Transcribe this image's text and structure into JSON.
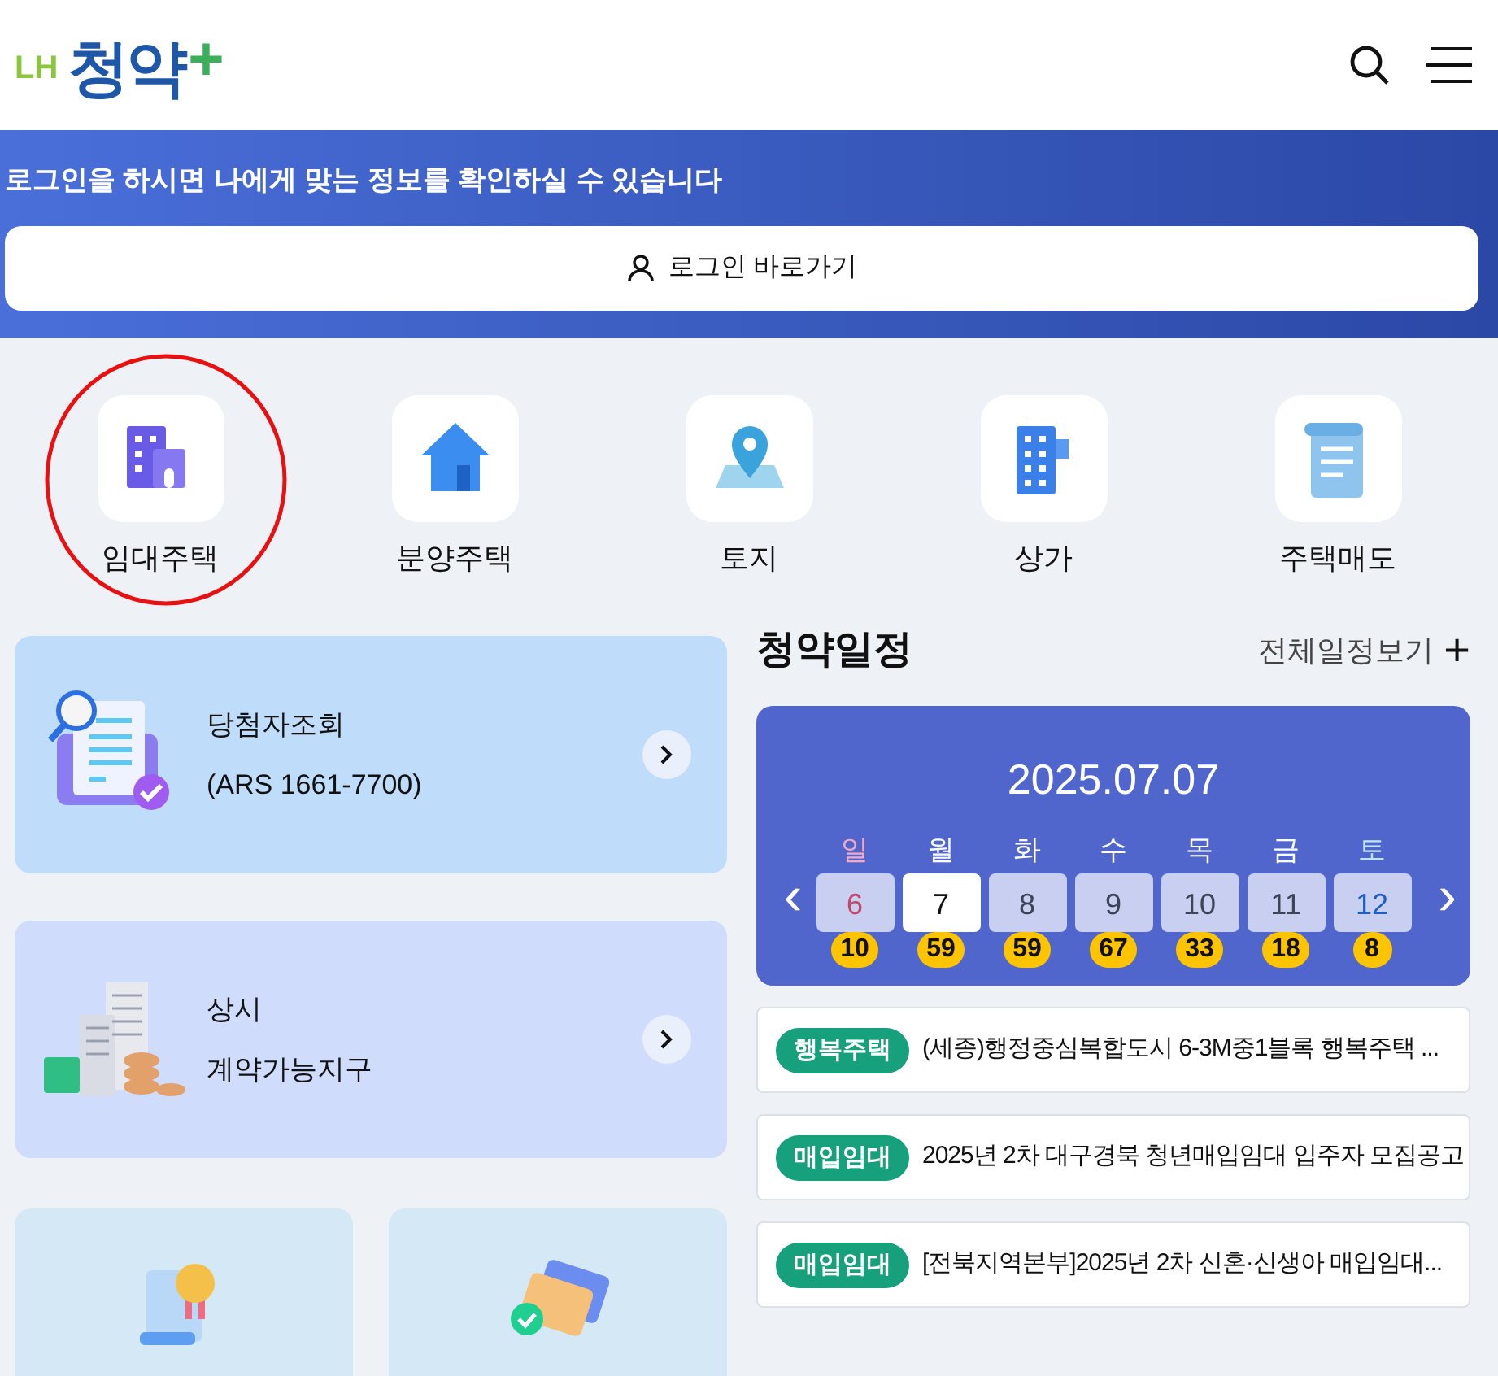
{
  "header": {
    "logo_prefix": "LH",
    "logo": "청약",
    "logo_plus": "+"
  },
  "banner": {
    "message": "로그인을 하시면 나에게 맞는 정보를 확인하실 수 있습니다",
    "login_button": "로그인 바로가기"
  },
  "quick_menu": [
    {
      "label": "임대주택",
      "kind": "rent",
      "highlighted": true
    },
    {
      "label": "분양주택",
      "kind": "sale",
      "highlighted": false
    },
    {
      "label": "토지",
      "kind": "land",
      "highlighted": false
    },
    {
      "label": "상가",
      "kind": "shop",
      "highlighted": false
    },
    {
      "label": "주택매도",
      "kind": "sell",
      "highlighted": false
    }
  ],
  "cards": [
    {
      "kind": "winner",
      "line1": "당첨자조회",
      "line2": "(ARS 1661-7700)"
    },
    {
      "kind": "contract",
      "line1": "상시",
      "line2": "계약가능지구"
    }
  ],
  "tiles": [
    {
      "kind": "award"
    },
    {
      "kind": "card"
    }
  ],
  "schedule": {
    "title": "청약일정",
    "more": "전체일정보기",
    "more_icon": "+",
    "date": "2025.07.07",
    "prev": "‹",
    "next": "›",
    "days": [
      {
        "weekday": "일",
        "day": "6",
        "count": "10",
        "kind": "sun",
        "selected": false
      },
      {
        "weekday": "월",
        "day": "7",
        "count": "59",
        "kind": "weekday",
        "selected": true
      },
      {
        "weekday": "화",
        "day": "8",
        "count": "59",
        "kind": "weekday",
        "selected": false
      },
      {
        "weekday": "수",
        "day": "9",
        "count": "67",
        "kind": "weekday",
        "selected": false
      },
      {
        "weekday": "목",
        "day": "10",
        "count": "33",
        "kind": "weekday",
        "selected": false
      },
      {
        "weekday": "금",
        "day": "11",
        "count": "18",
        "kind": "weekday",
        "selected": false
      },
      {
        "weekday": "토",
        "day": "12",
        "count": "8",
        "kind": "sat",
        "selected": false
      }
    ],
    "notices": [
      {
        "tag": "행복주택",
        "title": "(세종)행정중심복합도시 6-3M중1블록 행복주택 ..."
      },
      {
        "tag": "매입임대",
        "title": "2025년 2차 대구경북 청년매입임대 입주자 모집공고"
      },
      {
        "tag": "매입임대",
        "title": "[전북지역본부]2025년 2차 신혼·신생아 매입임대..."
      }
    ]
  }
}
